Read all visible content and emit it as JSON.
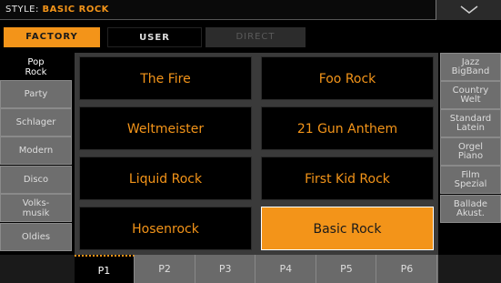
{
  "header": {
    "label": "STYLE:",
    "value": "BASIC ROCK"
  },
  "source_tabs": [
    {
      "label": "FACTORY",
      "state": "selected"
    },
    {
      "label": "USER",
      "state": "normal"
    },
    {
      "label": "DIRECT",
      "state": "disabled"
    }
  ],
  "left_categories": [
    {
      "label": "Pop\nRock",
      "active": true
    },
    {
      "label": "Party"
    },
    {
      "label": "Schlager"
    },
    {
      "label": "Modern"
    },
    {
      "label": "Disco"
    },
    {
      "label": "Volks-\nmusik"
    },
    {
      "label": "Oldies"
    }
  ],
  "right_categories": [
    {
      "label": "Jazz\nBigBand"
    },
    {
      "label": "Country\nWelt"
    },
    {
      "label": "Standard\nLatein"
    },
    {
      "label": "Orgel\nPiano"
    },
    {
      "label": "Film\nSpezial"
    },
    {
      "label": "Ballade\nAkust."
    }
  ],
  "styles": [
    {
      "name": "The Fire"
    },
    {
      "name": "Foo Rock"
    },
    {
      "name": "Weltmeister"
    },
    {
      "name": "21 Gun Anthem"
    },
    {
      "name": "Liquid Rock"
    },
    {
      "name": "First Kid Rock"
    },
    {
      "name": "Hosenrock"
    },
    {
      "name": "Basic Rock",
      "selected": true
    }
  ],
  "pages": [
    {
      "label": "P1",
      "active": true
    },
    {
      "label": "P2"
    },
    {
      "label": "P3"
    },
    {
      "label": "P4"
    },
    {
      "label": "P5"
    },
    {
      "label": "P6"
    }
  ],
  "colors": {
    "accent": "#f39419",
    "panel": "#6e6e6e",
    "background": "#000000"
  }
}
